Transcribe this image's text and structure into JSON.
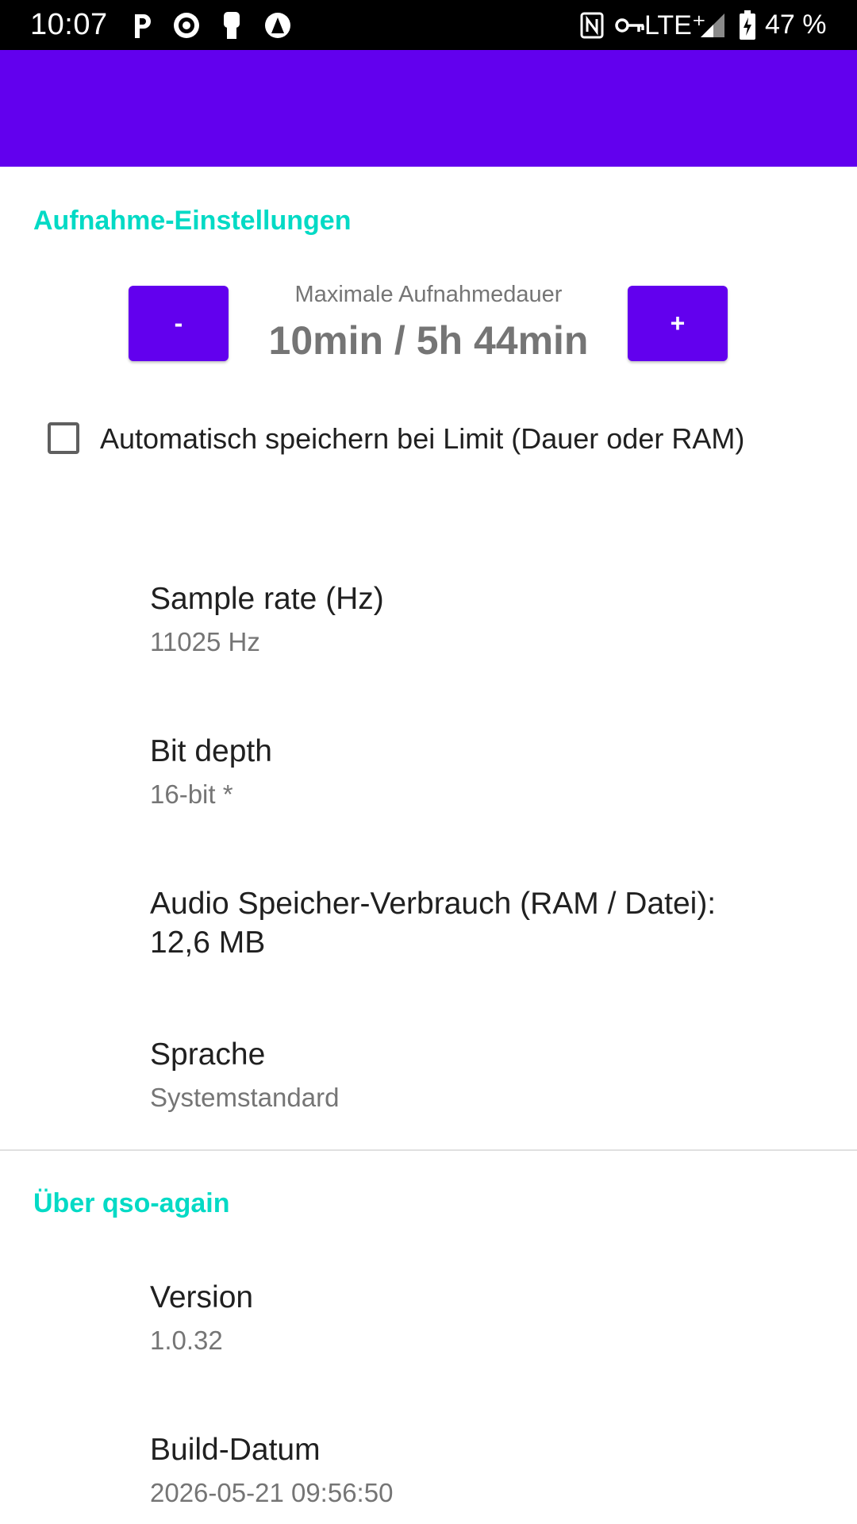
{
  "status_bar": {
    "time": "10:07",
    "network": "LTE⁺",
    "battery": "47 %",
    "left_icons": [
      "parking-icon",
      "notification-icon",
      "hand-icon",
      "app-icon"
    ],
    "right_icons": [
      "nfc-icon",
      "vpn-key-icon",
      "signal-icon",
      "battery-icon"
    ]
  },
  "colors": {
    "primary": "#6200EE",
    "accent": "#03DAC5"
  },
  "recording_settings": {
    "header": "Aufnahme-Einstellungen",
    "minus_label": "-",
    "plus_label": "+",
    "duration_label": "Maximale Aufnahmedauer",
    "duration_value": "10min / 5h 44min",
    "autosave_label": "Automatisch speichern bei Limit (Dauer oder RAM)",
    "autosave_checked": false
  },
  "preferences": {
    "sample_rate": {
      "title": "Sample rate (Hz)",
      "summary": "11025 Hz"
    },
    "bit_depth": {
      "title": "Bit depth",
      "summary": "16-bit *"
    },
    "memory": {
      "title_line1": "Audio Speicher-Verbrauch (RAM / Datei):",
      "title_line2": "12,6 MB"
    },
    "language": {
      "title": "Sprache",
      "summary": "Systemstandard"
    }
  },
  "about": {
    "header": "Über qso-again",
    "version": {
      "title": "Version",
      "summary": "1.0.32"
    },
    "build_date": {
      "title": "Build-Datum",
      "summary": "2026-05-21 09:56:50"
    }
  }
}
